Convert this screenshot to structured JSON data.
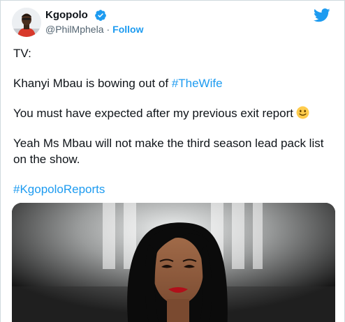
{
  "author": {
    "display_name": "Kgopolo",
    "handle": "@PhilMphela",
    "separator": "·",
    "follow_label": "Follow",
    "verified": true,
    "avatar_icon": "user-avatar"
  },
  "brand": {
    "icon": "twitter-bird-icon",
    "color": "#1d9bf0"
  },
  "tweet": {
    "line1": "TV:",
    "line2_text": "Khanyi Mbau is bowing out of ",
    "line2_hashtag": "#TheWife",
    "line3_text": "You must have expected after my previous exit report",
    "line3_emoji": "slightly-smiling-face",
    "line4": "Yeah Ms Mbau will not make the third season lead pack list on the show.",
    "hashtag2": "#KgopoloReports"
  },
  "media": {
    "type": "photo",
    "subject": "woman-portrait-photo"
  },
  "colors": {
    "text": "#0f1419",
    "secondary": "#536471",
    "link": "#1d9bf0",
    "border": "#cfd9de"
  }
}
